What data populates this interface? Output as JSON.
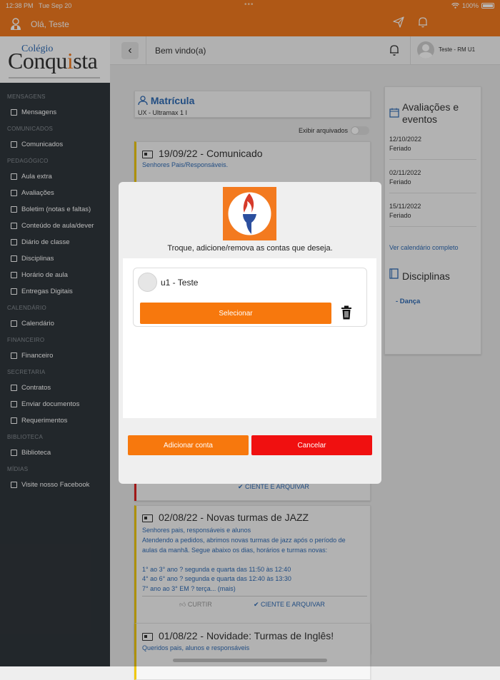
{
  "status_bar": {
    "time": "12:38 PM",
    "date": "Tue Sep 20",
    "dots": "•••",
    "battery": "100%"
  },
  "header": {
    "greeting": "Olá, Teste"
  },
  "logo": {
    "line1": "Colégio",
    "line2_a": "Conqu",
    "line2_i": "i",
    "line2_b": "sta"
  },
  "sidebar": {
    "sections": [
      {
        "title": "MENSAGENS",
        "items": [
          {
            "label": "Mensagens",
            "icon": "chat-icon"
          }
        ]
      },
      {
        "title": "COMUNICADOS",
        "items": [
          {
            "label": "Comunicados",
            "icon": "newspaper-icon"
          }
        ]
      },
      {
        "title": "PEDAGÓGICO",
        "items": [
          {
            "label": "Aula extra",
            "icon": "calendar-plus-icon"
          },
          {
            "label": "Avaliações",
            "icon": "pencil-icon"
          },
          {
            "label": "Boletim (notas e faltas)",
            "icon": "report-icon"
          },
          {
            "label": "Conteúdo de aula/dever",
            "icon": "file-icon"
          },
          {
            "label": "Diário de classe",
            "icon": "list-icon"
          },
          {
            "label": "Disciplinas",
            "icon": "book-icon"
          },
          {
            "label": "Horário de aula",
            "icon": "grid-icon"
          },
          {
            "label": "Entregas Digitais",
            "icon": "pencil-icon"
          }
        ]
      },
      {
        "title": "CALENDÁRIO",
        "items": [
          {
            "label": "Calendário",
            "icon": "calendar-icon"
          }
        ]
      },
      {
        "title": "FINANCEIRO",
        "items": [
          {
            "label": "Financeiro",
            "icon": "dollar-icon"
          }
        ]
      },
      {
        "title": "SECRETARIA",
        "items": [
          {
            "label": "Contratos",
            "icon": "pencil-icon"
          },
          {
            "label": "Enviar documentos",
            "icon": "inbox-icon"
          },
          {
            "label": "Requerimentos",
            "icon": "graduation-cap-icon"
          }
        ]
      },
      {
        "title": "BIBLIOTECA",
        "items": [
          {
            "label": "Biblioteca",
            "icon": "library-icon"
          }
        ]
      },
      {
        "title": "MÍDIAS",
        "items": [
          {
            "label": "Visite nosso Facebook",
            "icon": "facebook-icon"
          }
        ]
      }
    ]
  },
  "topbar": {
    "title": "Bem vindo(a)",
    "user": "Teste - RM U1"
  },
  "matricula": {
    "title": "Matrícula",
    "subtitle": "UX - Ultramax 1 I"
  },
  "toggle": {
    "label": "Exibir arquivados"
  },
  "news": [
    {
      "date_title": "19/09/22 - Comunicado",
      "audience": "Senhores Pais/Responsáveis."
    },
    {
      "date_title": "02/08/22 - Novas turmas de JAZZ",
      "audience": "Senhores pais, responsáveis e alunos",
      "body": [
        "Atendendo a pedidos, abrimos novas turmas de jazz após o período de",
        "aulas da manhã. Segue abaixo os dias, horários e turmas novas:",
        "",
        "1° ao 3° ano ? segunda e quarta das 11:50 às 12:40",
        "4° ao 6° ano ? segunda e quarta das 12:40 às 13:30",
        "7° ano ao 3° EM ? terça... (mais)"
      ],
      "like": "CURTIR",
      "ack": "CIENTE E ARQUIVAR"
    },
    {
      "date_title": "01/08/22 - Novidade: Turmas de Inglês!",
      "audience": "Queridos pais, alunos e responsáveis"
    }
  ],
  "first_ack": "CIENTE E ARQUIVAR",
  "events": {
    "title_line1": "Avaliações e",
    "title_line2": "eventos",
    "items": [
      {
        "date": "12/10/2022",
        "label": "Feriado"
      },
      {
        "date": "02/11/2022",
        "label": "Feriado"
      },
      {
        "date": "15/11/2022",
        "label": "Feriado"
      }
    ],
    "link": "Ver calendário completo"
  },
  "disciplinas": {
    "title": "Disciplinas",
    "items": [
      "- Dança"
    ]
  },
  "modal": {
    "prompt": "Troque, adicione/remova as contas que deseja.",
    "account_name": "u1 - Teste",
    "select_label": "Selecionar",
    "add_label": "Adicionar conta",
    "cancel_label": "Cancelar",
    "colors": {
      "orange": "#f7780d",
      "red": "#f01010"
    }
  }
}
